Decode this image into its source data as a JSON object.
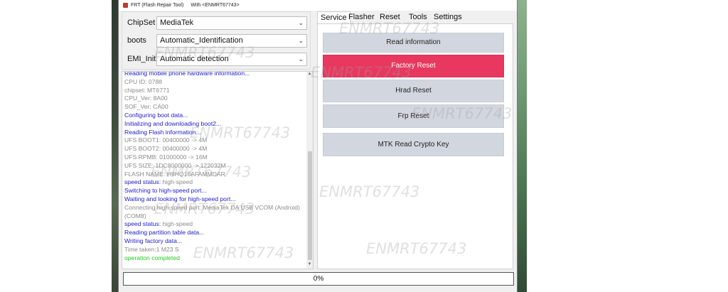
{
  "window": {
    "title": "FRT (Flash Repair Tool)",
    "title_with": "With <ENMRT67743>"
  },
  "combos": {
    "chipset": {
      "label": "ChipSet",
      "value": "MediaTek"
    },
    "boots": {
      "label": "boots",
      "value": "Automatic_Identification"
    },
    "emi": {
      "label": "EMI_Init",
      "value": "Automatic detection"
    }
  },
  "log": [
    {
      "text": "Reading mobile phone hardware information...",
      "style": "blue"
    },
    {
      "text": "CPU ID: 0788",
      "style": "gray"
    },
    {
      "text": "chipset: MT6771",
      "style": "gray"
    },
    {
      "text": "CPU_Ver: 8A00",
      "style": "gray"
    },
    {
      "text": "SOF_Ver: CA00",
      "style": "gray"
    },
    {
      "text": "Configuring boot data...",
      "style": "blue"
    },
    {
      "text": " Initializing and downloading boot2...",
      "style": "blue"
    },
    {
      "text": "Reading Flash information...",
      "style": "blue"
    },
    {
      "text": "UFS BOOT1: 00400000 -> 4M",
      "style": "gray"
    },
    {
      "text": "UFS BOOT2: 00400000 -> 4M",
      "style": "gray"
    },
    {
      "text": "UFS RPMB: 01000000 -> 16M",
      "style": "gray"
    },
    {
      "text": "UFS SIZE: 1DC8000000 -> 122032M",
      "style": "gray"
    },
    {
      "text": "FLASH NAME: H9HQ16AFAMMDAR",
      "style": "gray"
    },
    {
      "key": "speed status: ",
      "value": "high-speed",
      "style": "kv"
    },
    {
      "text": "Switching to high-speed port...",
      "style": "blue"
    },
    {
      "text": "Waiting and looking for high-speed port...",
      "style": "blue"
    },
    {
      "text": " Connecting high-speed port: MediaTek DA USB VCOM (Android) (COM8)",
      "style": "gray-wrap"
    },
    {
      "key": "speed status: ",
      "value": "high-speed",
      "style": "kv"
    },
    {
      "text": "Reading partition table data...",
      "style": "blue"
    },
    {
      "text": "Writing factory data...",
      "style": "blue"
    },
    {
      "text": " Time taken:1 M23 S",
      "style": "gray"
    },
    {
      "text": "operation completed",
      "style": "green"
    }
  ],
  "tabs": [
    {
      "label": "Service",
      "active": true
    },
    {
      "label": "Flasher",
      "active": false
    },
    {
      "label": "Reset",
      "active": false
    },
    {
      "label": "Tools",
      "active": false
    },
    {
      "label": "Settings",
      "active": false
    }
  ],
  "service_buttons": [
    {
      "label": "Read information",
      "danger": false
    },
    {
      "label": "Factory Reset",
      "danger": true
    },
    {
      "label": "Hrad Reset",
      "danger": false
    },
    {
      "label": "Frp Reset",
      "danger": false
    },
    {
      "label": "MTK Read Crypto Key",
      "danger": false
    }
  ],
  "progress": {
    "label": "0%",
    "value": 0
  },
  "watermark": "ENMRT67743",
  "colors": {
    "danger_button": "#e8385f",
    "service_button": "#d2d7df",
    "log_blue": "#2020d0",
    "log_gray": "#8a8a8a",
    "log_green": "#22cc22"
  }
}
